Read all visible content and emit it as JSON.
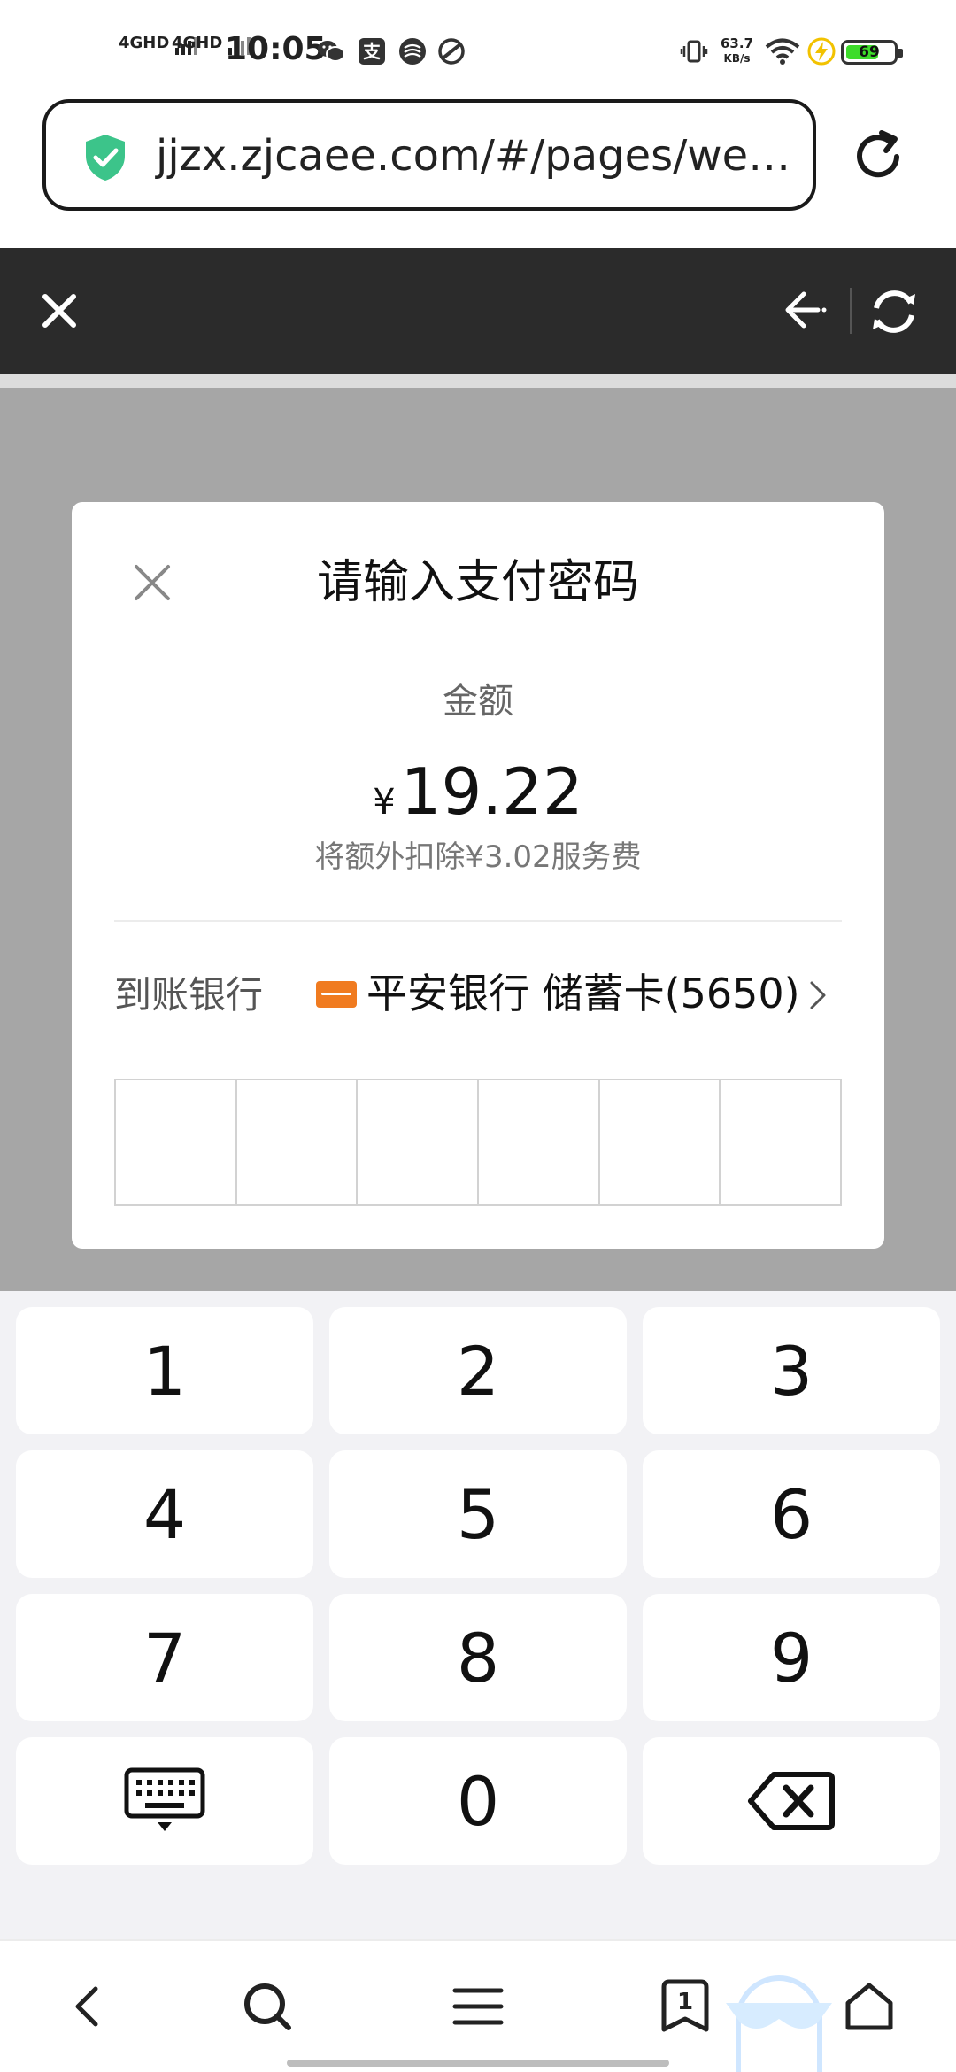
{
  "status_bar": {
    "signal_1": "4GHD",
    "signal_2": "4GHD",
    "time": "10:05",
    "net_speed_value": "63.7",
    "net_speed_unit": "KB/s",
    "battery": "69",
    "battery_level": 0.69,
    "icons": [
      "wechat-icon",
      "alipay-icon",
      "china-mobile-icon",
      "app-icon",
      "vibrate-icon",
      "wifi-icon",
      "charging-icon"
    ]
  },
  "browser": {
    "url": "jjzx.zjcaee.com/#/pages/we…",
    "icons": [
      "shield-check-icon",
      "reload-icon"
    ]
  },
  "toolbar": {
    "icons": [
      "close-icon",
      "back-arrow-icon",
      "refresh-icon"
    ]
  },
  "dialog": {
    "title": "请输入支付密码",
    "amount_label": "金额",
    "currency": "¥",
    "amount": "19.22",
    "fee_note": "将额外扣除¥3.02服务费",
    "bank_label": "到账银行",
    "bank_name": "平安银行 储蓄卡(5650)",
    "pin_length": 6
  },
  "keypad": {
    "keys": [
      "1",
      "2",
      "3",
      "4",
      "5",
      "6",
      "7",
      "8",
      "9",
      "keyboard",
      "0",
      "backspace"
    ]
  },
  "bottom_nav": {
    "tab_count": "1",
    "icons": [
      "back-icon",
      "search-icon",
      "menu-icon",
      "tabs-icon",
      "home-icon",
      "assistant-icon"
    ]
  },
  "colors": {
    "toolbar": "#2b2b2b",
    "overlay": "#a6a6a6",
    "shield": "#3cc48a",
    "battery": "#3ddc2a",
    "bank_logo": "#f07b20",
    "keypad_bg": "#f2f2f5"
  }
}
